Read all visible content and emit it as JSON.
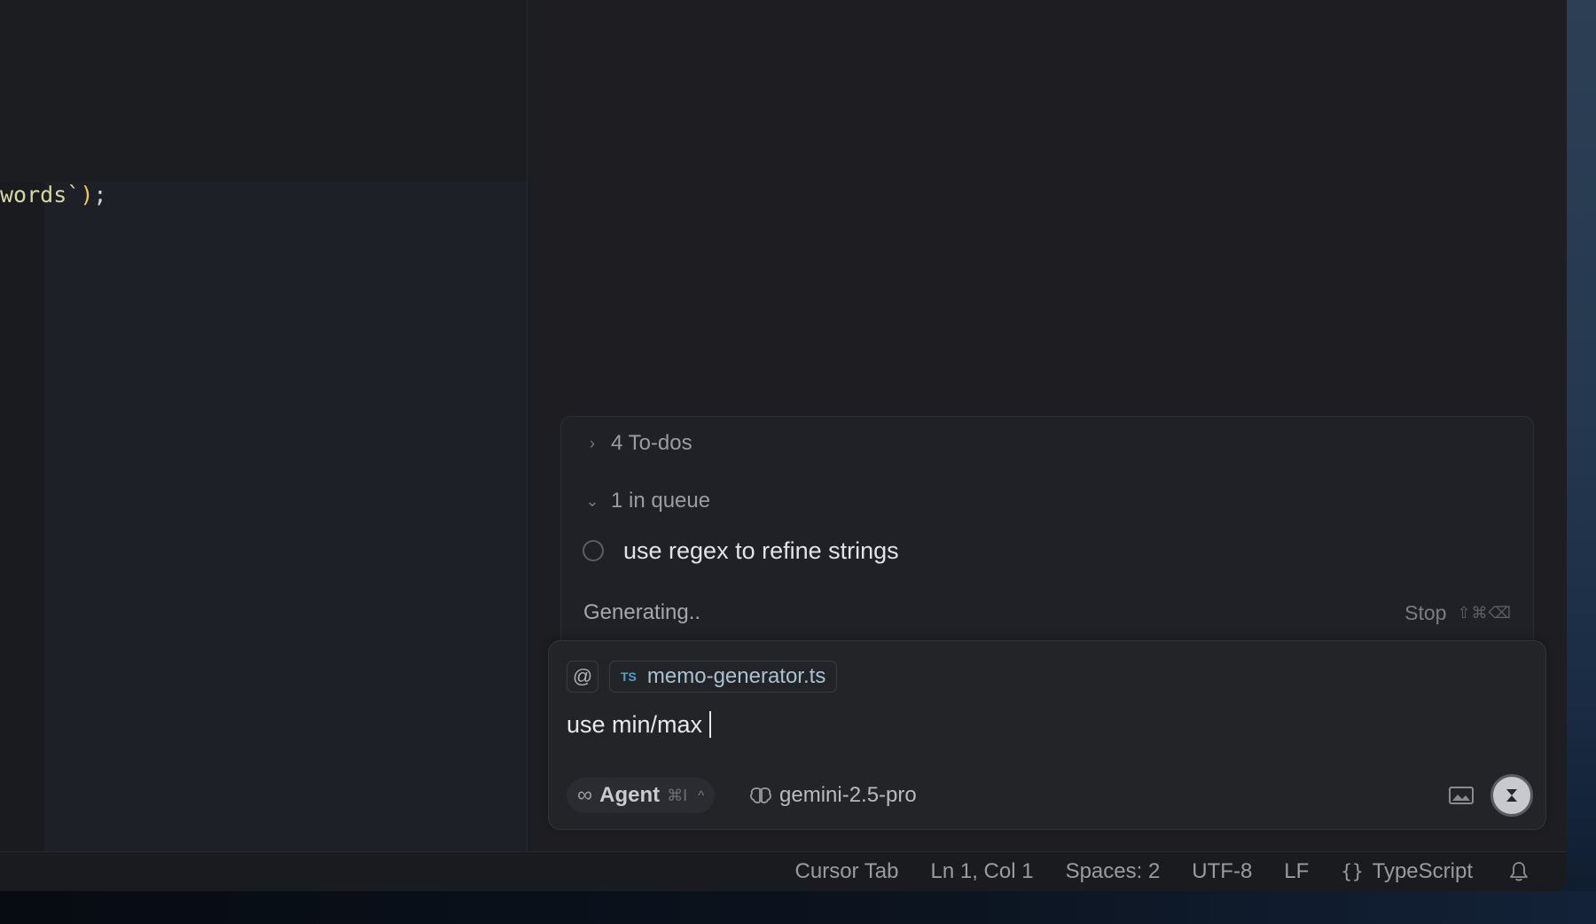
{
  "editor": {
    "code_tokens": {
      "str": "words`",
      "paren": ")",
      "punc": ";"
    }
  },
  "queue": {
    "todos_label": "4 To-dos",
    "queue_label": "1 in queue",
    "items": [
      {
        "text": "use regex to refine strings"
      }
    ],
    "status": "Generating..",
    "stop_label": "Stop",
    "stop_shortcut": "⇧⌘⌫"
  },
  "composer": {
    "at_symbol": "@",
    "attached_file": {
      "badge": "TS",
      "name": "memo-generator.ts"
    },
    "input_value": "use min/max",
    "mode": {
      "label": "Agent",
      "shortcut": "⌘I"
    },
    "model": "gemini-2.5-pro"
  },
  "statusbar": {
    "cursor_tab": "Cursor Tab",
    "position": "Ln 1, Col 1",
    "spaces": "Spaces: 2",
    "encoding": "UTF-8",
    "eol": "LF",
    "language_icon": "{}",
    "language": "TypeScript"
  },
  "icons": {
    "chevron_right": "chevron-right-icon",
    "chevron_down": "chevron-down-icon",
    "infinity": "infinity-icon",
    "brain": "brain-icon",
    "image": "image-icon",
    "stop": "stop-icon",
    "bell": "bell-icon"
  },
  "colors": {
    "accent_ts": "#4aa3c9",
    "string": "#d8d6a2",
    "paren": "#f2c94c"
  }
}
